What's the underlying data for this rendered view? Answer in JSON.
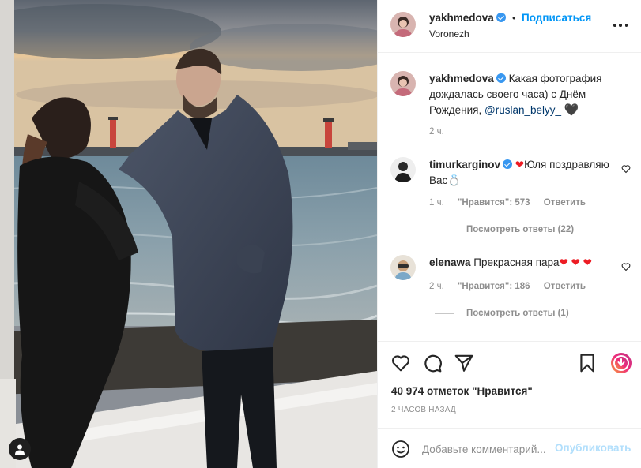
{
  "post": {
    "username": "yakhmedova",
    "follow_label": "Подписаться",
    "separator": "•",
    "location": "Voronezh"
  },
  "caption": {
    "username": "yakhmedova",
    "text": "Какая фотография дождалась своего часа) с Днём Рождения,",
    "mention": "@ruslan_belyy_",
    "time": "2 ч."
  },
  "comments": [
    {
      "username": "timurkarginov",
      "text": "Юля поздравляю Вас",
      "time": "1 ч.",
      "likes": "\"Нравится\": 573",
      "reply": "Ответить",
      "view_replies": "Посмотреть ответы (22)"
    },
    {
      "username": "elenawa",
      "text": "Прекрасная пара",
      "time": "2 ч.",
      "likes": "\"Нравится\": 186",
      "reply": "Ответить",
      "view_replies": "Посмотреть ответы (1)"
    }
  ],
  "stats": {
    "likes": "40 974 отметок \"Нравится\"",
    "time_ago": "2 ЧАСОВ НАЗАД"
  },
  "composer": {
    "placeholder": "Добавьте комментарий...",
    "post_label": "Опубликовать"
  },
  "icons": {
    "like": "heart-icon",
    "comment": "comment-icon",
    "share": "share-icon",
    "save": "bookmark-icon",
    "emoji": "emoji-icon",
    "more": "more-icon",
    "reels": "reels-icon"
  },
  "colors": {
    "accent": "#0095f6",
    "verified": "#3897f0",
    "muted": "#8e8e8e",
    "post_disabled": "#b2dffc",
    "heart_red": "#ed1c24"
  }
}
